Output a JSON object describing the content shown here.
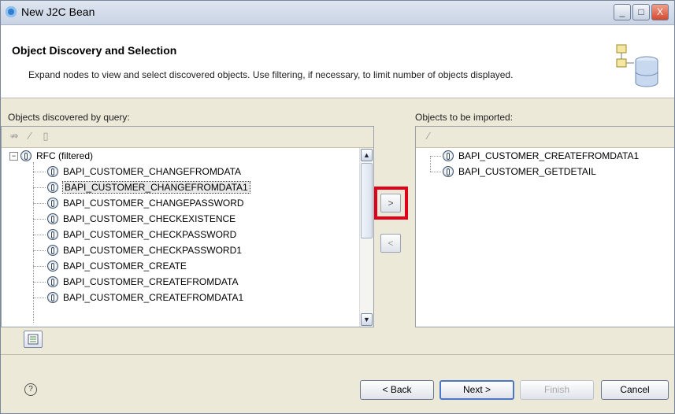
{
  "window": {
    "title": "New J2C Bean",
    "controls": {
      "minimize": "_",
      "maximize": "□",
      "close": "X"
    }
  },
  "banner": {
    "title": "Object Discovery and Selection",
    "description": "Expand nodes to view and select discovered objects. Use filtering, if necessary, to limit number of objects displayed.",
    "icon": "database-wizard-icon"
  },
  "left_panel": {
    "label": "Objects discovered by query:",
    "toolbar_icons": [
      "filter-icon",
      "edit-icon",
      "book-icon"
    ],
    "root": {
      "label": "RFC (filtered)",
      "expanded": true,
      "icon": "rfc-folder-icon"
    },
    "items": [
      {
        "label": "BAPI_CUSTOMER_CHANGEFROMDATA"
      },
      {
        "label": "BAPI_CUSTOMER_CHANGEFROMDATA1",
        "selected": true
      },
      {
        "label": "BAPI_CUSTOMER_CHANGEPASSWORD"
      },
      {
        "label": "BAPI_CUSTOMER_CHECKEXISTENCE"
      },
      {
        "label": "BAPI_CUSTOMER_CHECKPASSWORD"
      },
      {
        "label": "BAPI_CUSTOMER_CHECKPASSWORD1"
      },
      {
        "label": "BAPI_CUSTOMER_CREATE"
      },
      {
        "label": "BAPI_CUSTOMER_CREATEFROMDATA"
      },
      {
        "label": "BAPI_CUSTOMER_CREATEFROMDATA1"
      }
    ]
  },
  "move_buttons": {
    "add": ">",
    "remove": "<"
  },
  "right_panel": {
    "label": "Objects to be imported:",
    "toolbar_icons": [
      "edit-icon"
    ],
    "items": [
      {
        "label": "BAPI_CUSTOMER_CREATEFROMDATA1"
      },
      {
        "label": "BAPI_CUSTOMER_GETDETAIL"
      }
    ]
  },
  "footer": {
    "help": "?",
    "back": "< Back",
    "next": "Next >",
    "finish": "Finish",
    "cancel": "Cancel"
  },
  "colors": {
    "highlight": "#e0001b",
    "accent": "#4a78c6"
  }
}
